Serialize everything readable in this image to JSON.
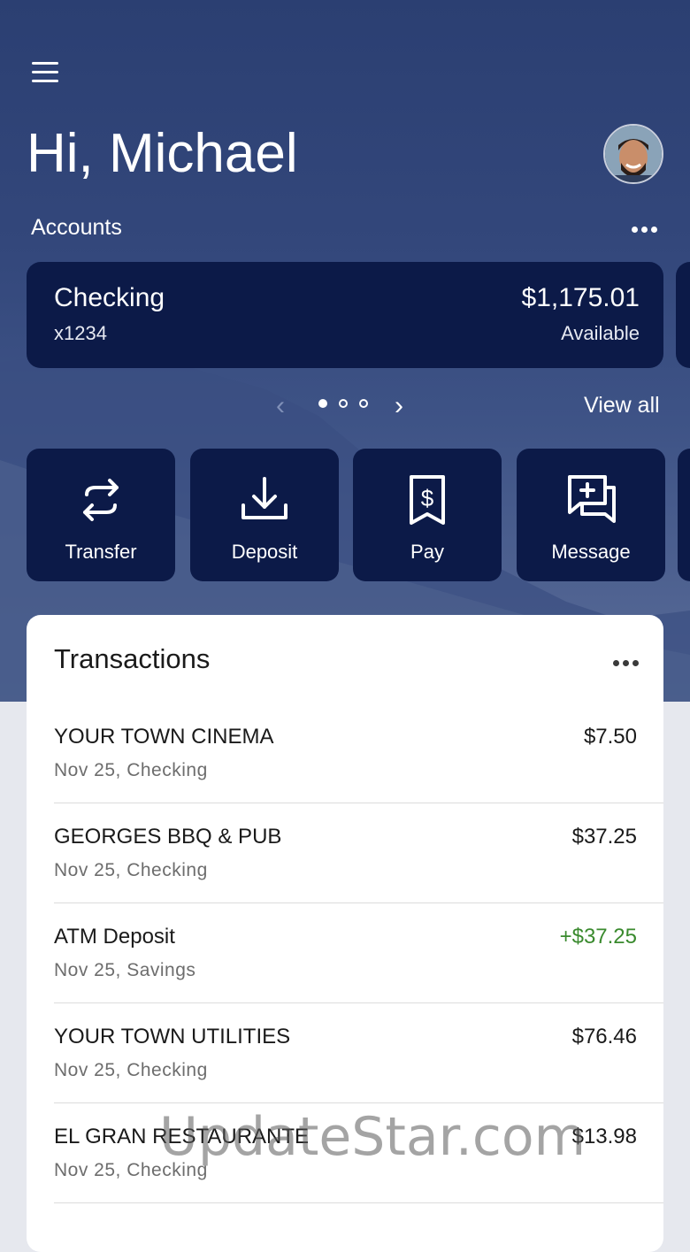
{
  "header": {
    "greeting": "Hi, Michael"
  },
  "accounts": {
    "label": "Accounts",
    "card": {
      "name": "Checking",
      "number": "x1234",
      "balance": "$1,175.01",
      "balance_label": "Available"
    },
    "pager": {
      "total": 3,
      "current": 1
    },
    "view_all": "View all"
  },
  "actions": [
    {
      "label": "Transfer",
      "icon": "transfer-icon"
    },
    {
      "label": "Deposit",
      "icon": "deposit-icon"
    },
    {
      "label": "Pay",
      "icon": "bill-icon"
    },
    {
      "label": "Message",
      "icon": "message-icon"
    }
  ],
  "transactions": {
    "title": "Transactions",
    "items": [
      {
        "merchant": "YOUR TOWN CINEMA",
        "meta": "Nov 25, Checking",
        "amount": "$7.50",
        "credit": false
      },
      {
        "merchant": "GEORGES BBQ & PUB",
        "meta": "Nov 25, Checking",
        "amount": "$37.25",
        "credit": false
      },
      {
        "merchant": "ATM Deposit",
        "meta": "Nov 25, Savings",
        "amount": "+$37.25",
        "credit": true
      },
      {
        "merchant": "YOUR TOWN UTILITIES",
        "meta": "Nov 25, Checking",
        "amount": "$76.46",
        "credit": false
      },
      {
        "merchant": "EL GRAN RESTAURANTE",
        "meta": "Nov 25, Checking",
        "amount": "$13.98",
        "credit": false
      }
    ]
  },
  "colors": {
    "card_bg": "#0c1a48",
    "credit": "#3a8a2e"
  },
  "watermark": "UpdateStar.com"
}
